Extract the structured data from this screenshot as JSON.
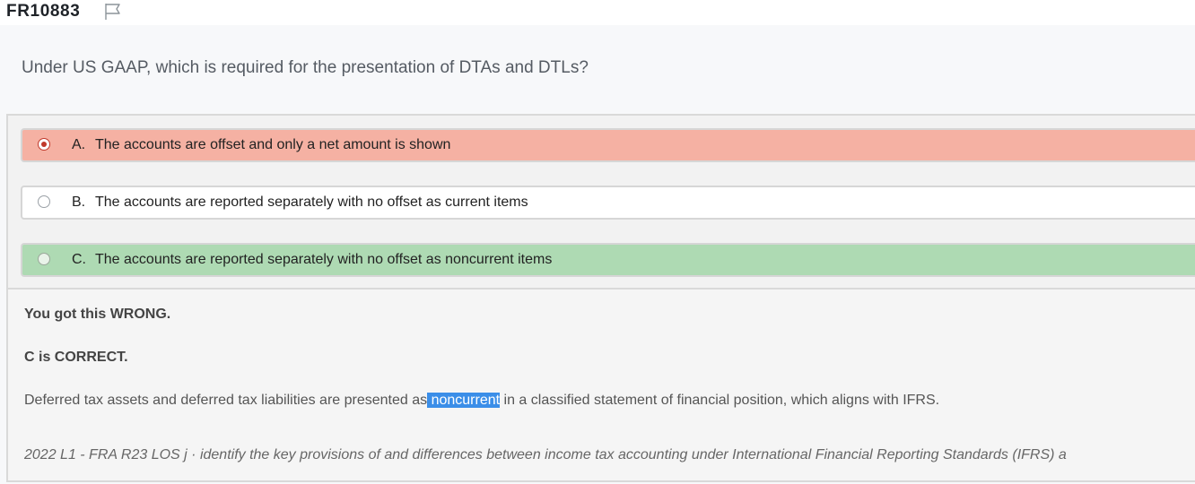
{
  "header": {
    "question_id": "FR10883",
    "flag_icon": "flag-outline-icon"
  },
  "question": {
    "text": "Under US GAAP, which is required for the presentation of DTAs and DTLs?"
  },
  "options": [
    {
      "letter": "A.",
      "text": "The accounts are offset and only a net amount is shown",
      "state": "selected-wrong",
      "color": "#f5b1a3"
    },
    {
      "letter": "B.",
      "text": "The accounts are reported separately with no offset as current items",
      "state": "unselected",
      "color": "#ffffff"
    },
    {
      "letter": "C.",
      "text": "The accounts are reported separately with no offset as noncurrent items",
      "state": "correct",
      "color": "#aedab3"
    }
  ],
  "explanation": {
    "result": "You got this WRONG.",
    "correct": "C is CORRECT.",
    "text_before": "Deferred tax assets and deferred tax liabilities are presented as",
    "highlight": " noncurrent",
    "text_after": " in a classified statement of financial position, which aligns with IFRS.",
    "highlight_color": "#3b8ee8",
    "los": "2022 L1 - FRA R23 LOS j · identify the key provisions of and differences between income tax accounting under International Financial Reporting Standards (IFRS) a"
  }
}
